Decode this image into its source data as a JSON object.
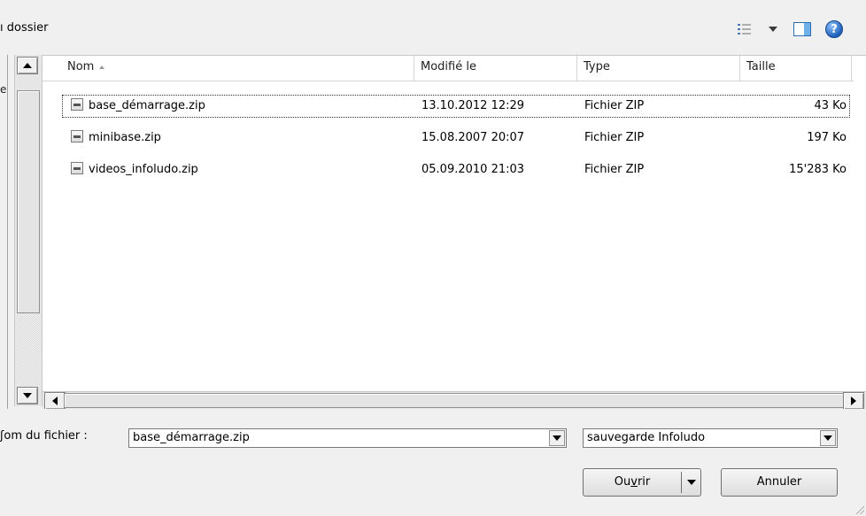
{
  "toolbar": {
    "folder_label": "ı dossier",
    "views_icon": "views-icon",
    "preview_icon": "preview-pane-icon",
    "help_glyph": "?"
  },
  "nav": {
    "cut_text": "e"
  },
  "columns": {
    "name": "Nom",
    "modified": "Modifié le",
    "type": "Type",
    "size": "Taille"
  },
  "files": [
    {
      "name": "base_démarrage.zip",
      "modified": "13.10.2012 12:29",
      "type": "Fichier ZIP",
      "size": "43 Ko"
    },
    {
      "name": "minibase.zip",
      "modified": "15.08.2007 20:07",
      "type": "Fichier ZIP",
      "size": "197 Ko"
    },
    {
      "name": "videos_infoludo.zip",
      "modified": "05.09.2010 21:03",
      "type": "Fichier ZIP",
      "size": "15'283 Ko"
    }
  ],
  "bottom": {
    "filename_label": "ʃom du fichier :",
    "filename_value": "base_démarrage.zip",
    "filter_value": "sauvegarde Infoludo",
    "open_pre": "Ou",
    "open_ul": "v",
    "open_post": "rir",
    "cancel_label": "Annuler"
  }
}
